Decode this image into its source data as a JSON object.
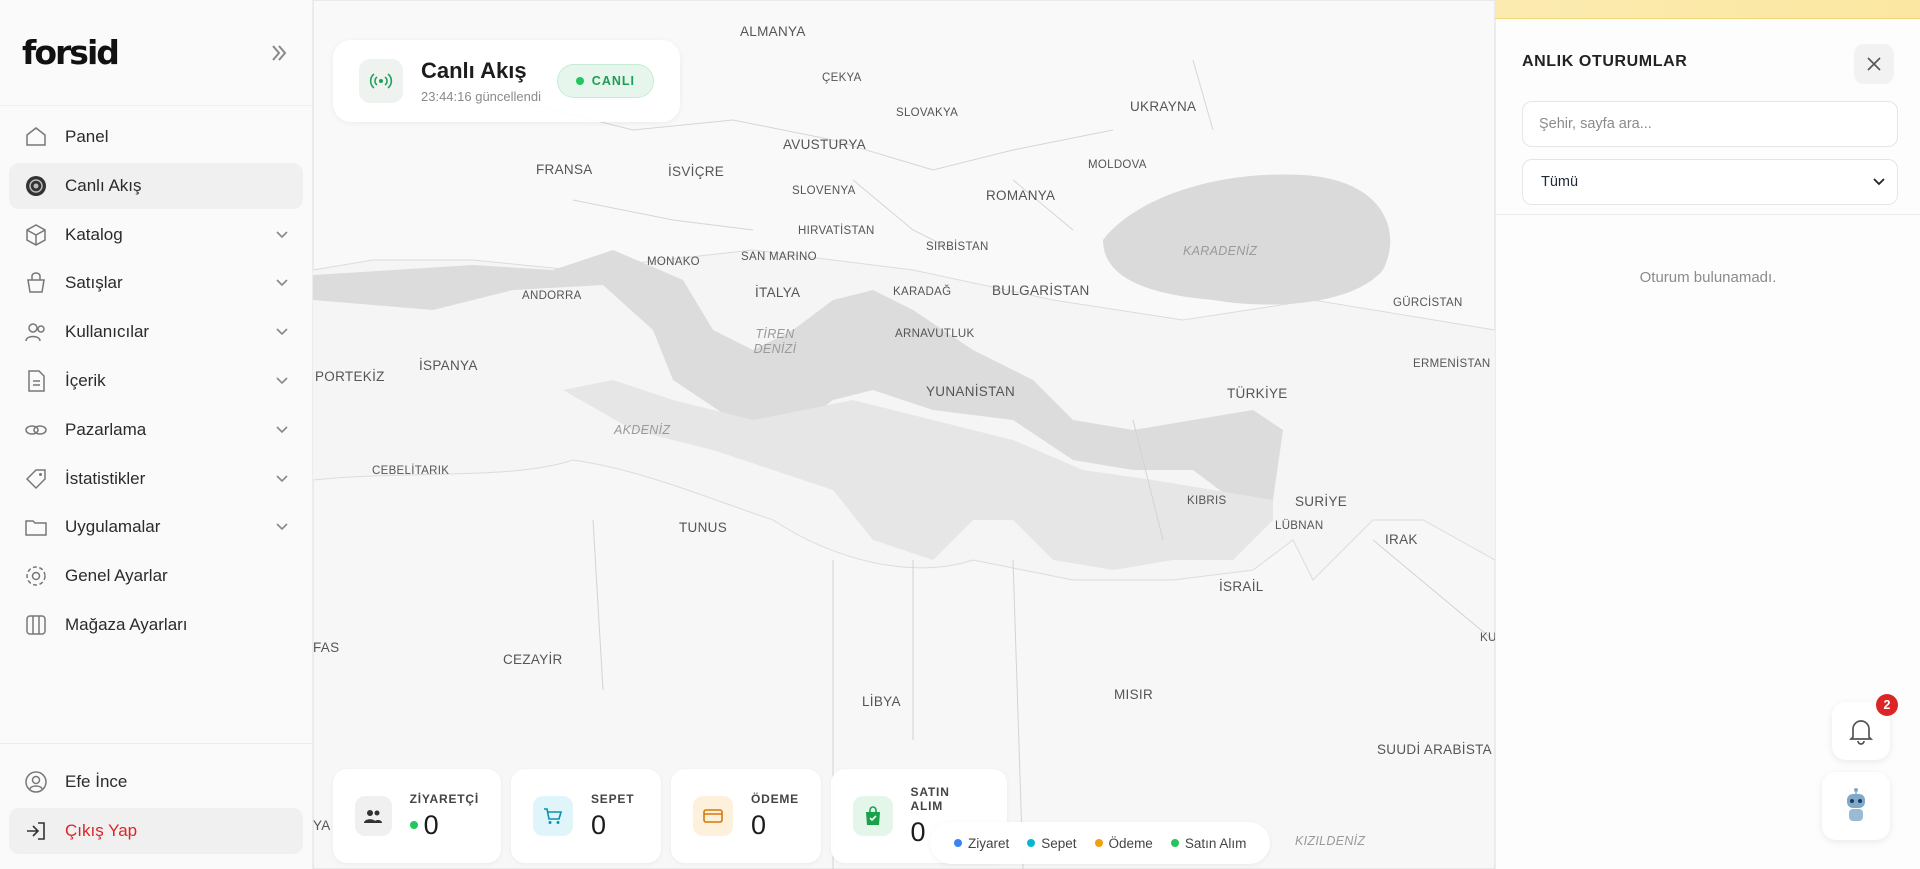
{
  "sidebar": {
    "logo": "forsid",
    "items": [
      {
        "label": "Panel"
      },
      {
        "label": "Canlı Akış"
      },
      {
        "label": "Katalog"
      },
      {
        "label": "Satışlar"
      },
      {
        "label": "Kullanıcılar"
      },
      {
        "label": "İçerik"
      },
      {
        "label": "Pazarlama"
      },
      {
        "label": "İstatistikler"
      },
      {
        "label": "Uygulamalar"
      },
      {
        "label": "Genel Ayarlar"
      },
      {
        "label": "Mağaza Ayarları"
      }
    ],
    "user_name": "Efe İnce",
    "logout_label": "Çıkış Yap"
  },
  "live": {
    "title": "Canlı Akış",
    "updated": "23:44:16 güncellendi",
    "badge": "CANLI"
  },
  "stats": [
    {
      "label": "ZİYARETÇİ",
      "value": "0"
    },
    {
      "label": "SEPET",
      "value": "0"
    },
    {
      "label": "ÖDEME",
      "value": "0"
    },
    {
      "label": "SATIN ALIM",
      "value": "0"
    }
  ],
  "legend": [
    "Ziyaret",
    "Sepet",
    "Ödeme",
    "Satın Alım"
  ],
  "colors": {
    "visit": "#3b82f6",
    "cart": "#06b6d4",
    "payment": "#f59e0b",
    "purchase": "#22c55e",
    "accent_red": "#dc2626"
  },
  "map": {
    "countries": [
      "ALMANYA",
      "ÇEKYA",
      "UKRAYNA",
      "SLOVAKYA",
      "AVUSTURYA",
      "FRANSA",
      "İSVİÇRE",
      "MOLDOVA",
      "SLOVENYA",
      "ROMANYA",
      "HIRVATİSTAN",
      "SIRBİSTAN",
      "MONAKO",
      "SAN MARINO",
      "ANDORRA",
      "İTALYA",
      "KARADAĞ",
      "BULGARİSTAN",
      "GÜRCİSTAN",
      "ARNAVUTLUK",
      "PORTEKİZ",
      "İSPANYA",
      "ERMENİSTAN",
      "YUNANİSTAN",
      "TÜRKİYE",
      "CEBELİTARIK",
      "KIBRIS",
      "SURİYE",
      "LÜBNAN",
      "IRAK",
      "TUNUS",
      "İSRAİL",
      "FAS",
      "CEZAYİR",
      "LİBYA",
      "MISIR",
      "SUUDİ ARABİSTA",
      "YA",
      "KU"
    ],
    "seas": [
      "KARADENİZ",
      "TİREN DENİZİ",
      "AKDENİZ",
      "KIZILDENİZ"
    ]
  },
  "panel": {
    "title": "ANLIK OTURUMLAR",
    "search_placeholder": "Şehir, sayfa ara...",
    "filter_value": "Tümü",
    "empty": "Oturum bulunamadı.",
    "notification_count": "2"
  }
}
